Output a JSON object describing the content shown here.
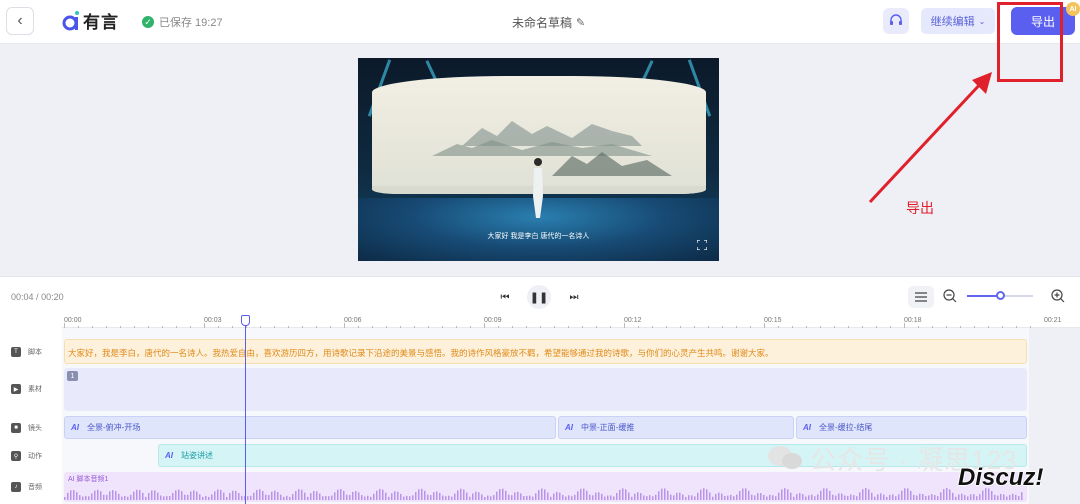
{
  "header": {
    "back_icon": "chevron-left-icon",
    "logo_text": "有言",
    "saved_text": "已保存 19:27",
    "doc_title": "未命名草稿",
    "headset_icon": "headset-icon",
    "continue_label": "继续编辑",
    "export_label": "导出",
    "ai_badge": "AI",
    "accent": "#5b5ff0"
  },
  "preview": {
    "caption": "大家好 我是李白 唐代的一名诗人"
  },
  "annotation": {
    "text": "导出",
    "color": "#e0202a"
  },
  "timeline": {
    "current_time": "00:04",
    "total_time": "00:20",
    "zoom_level": 0.5,
    "ruler": [
      "00:00",
      "00:03",
      "00:06",
      "00:09",
      "00:12",
      "00:15",
      "00:18",
      "00:21"
    ],
    "tracks": [
      {
        "label": "脚本",
        "icon": "T"
      },
      {
        "label": "素材",
        "icon": "▶"
      },
      {
        "label": "镜头",
        "icon": "■"
      },
      {
        "label": "动作",
        "icon": "⚲"
      },
      {
        "label": "音频",
        "icon": "♪"
      }
    ],
    "script_text": "大家好，我是李白，唐代的一名诗人。我热爱自由，喜欢游历四方，用诗歌记录下沿途的美景与感悟。我的诗作风格豪放不羁，希望能够通过我的诗歌，与你们的心灵产生共鸣。谢谢大家。",
    "material_index": "1",
    "shots": [
      {
        "ai": "AI",
        "label": "全景-俯冲-开场"
      },
      {
        "ai": "AI",
        "label": "中景-正面-缓推"
      },
      {
        "ai": "AI",
        "label": "全景-缓拉-结尾"
      }
    ],
    "action": {
      "ai": "AI",
      "label": "站姿讲述"
    },
    "audio_label": "AI 脚本音频1"
  },
  "watermark": {
    "text": "公众号 · 凝思123",
    "site": "Discuz!"
  }
}
